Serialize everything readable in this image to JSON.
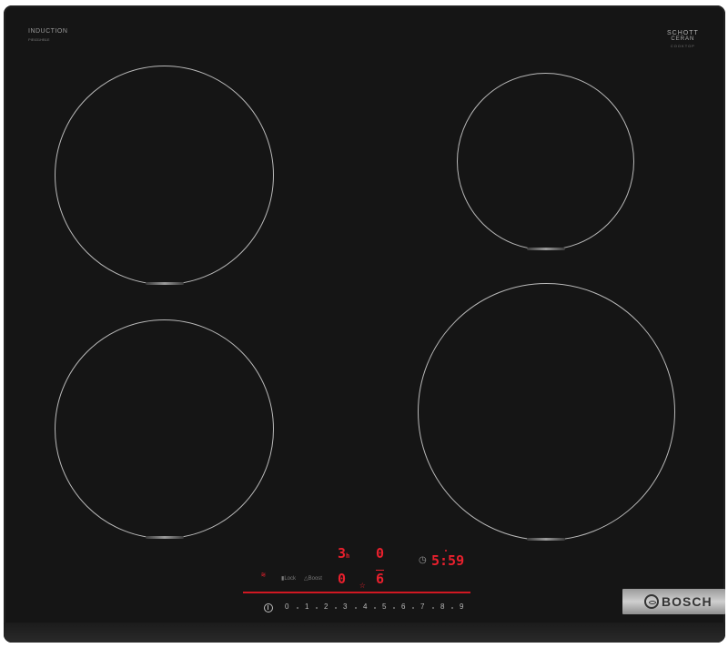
{
  "hob": {
    "label_top_left": "INDUCTION",
    "model_code": "PIE631HB1E",
    "schott_line1": "SCHOTT",
    "schott_line2": "CERAN",
    "schott_sub": "COOKTOP"
  },
  "display": {
    "zone_back_left": "3",
    "zone_back_left_sub": "h",
    "zone_back_right": "0",
    "zone_front_left": "0",
    "zone_front_right": "6",
    "timer": "5:59"
  },
  "controls": {
    "scale": [
      "0",
      "1",
      "2",
      "3",
      "4",
      "5",
      "6",
      "7",
      "8",
      "9"
    ],
    "child_lock_label": "Lock",
    "boost_label": "Boost"
  },
  "brand": {
    "name": "BOSCH"
  },
  "colors": {
    "glass": "#151515",
    "display_red": "#e9202d",
    "zone_outline": "#b9b9b9",
    "badge_silver": "#bcbcbc"
  },
  "icons": [
    "power-icon",
    "wifi-icon",
    "star-icon",
    "clock-icon",
    "lock-icon",
    "boost-icon",
    "bosch-logo-icon"
  ]
}
